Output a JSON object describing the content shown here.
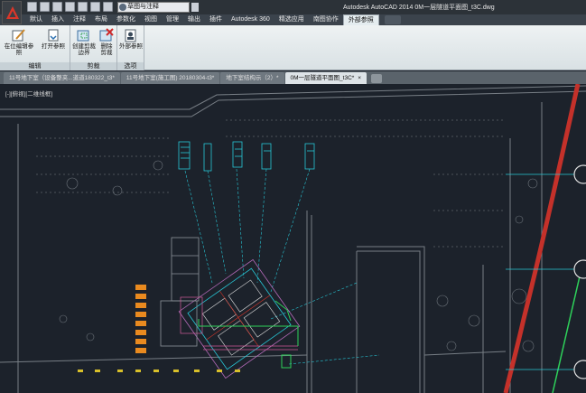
{
  "quick_access": {
    "workspace": "草图与注释",
    "icons": [
      "new-icon",
      "open-icon",
      "save-icon",
      "save-as-icon",
      "print-icon",
      "undo-icon",
      "redo-icon"
    ]
  },
  "app_title": "Autodesk AutoCAD 2014    0M一层隧道平面图_t3C.dwg",
  "ribbon_tabs": [
    {
      "label": "默认"
    },
    {
      "label": "插入"
    },
    {
      "label": "注释"
    },
    {
      "label": "布局"
    },
    {
      "label": "参数化"
    },
    {
      "label": "视图"
    },
    {
      "label": "管理"
    },
    {
      "label": "输出"
    },
    {
      "label": "插件"
    },
    {
      "label": "Autodesk 360"
    },
    {
      "label": "精选应用"
    },
    {
      "label": "南图协作"
    },
    {
      "label": "外部参照"
    }
  ],
  "ribbon_active_tab": "外部参照",
  "ribbon_groups": {
    "edit": {
      "label": "编辑",
      "buttons": [
        {
          "line1": "在位编辑参照",
          "line2": ""
        },
        {
          "line1": "打开参照",
          "line2": ""
        }
      ]
    },
    "clip": {
      "label": "剪裁",
      "buttons": [
        {
          "line1": "创建剪裁",
          "line2": "边界"
        },
        {
          "line1": "删除",
          "line2": "剪裁"
        }
      ]
    },
    "options": {
      "label": "选项",
      "buttons": [
        {
          "line1": "外部参照",
          "line2": ""
        }
      ]
    }
  },
  "doc_tabs": [
    {
      "label": "11号地下室（设备整夹...道道180322_t3*"
    },
    {
      "label": "11号地下室(施工图) 20180304-t3*"
    },
    {
      "label": "地下室结构示（2）*"
    },
    {
      "label": "0M一层隧道平面图_t3C*",
      "close": "×"
    }
  ],
  "viewport_label": "[-][俯视][二维线框]",
  "colors": {
    "canvas_bg": "#1c222b",
    "ribbon_bg": "#e4ecef",
    "accent_red": "#d9372a",
    "cad_cyan": "#27c7d6",
    "cad_green": "#2ed15a",
    "cad_orange": "#e98a1f",
    "cad_red_road": "#c4312a"
  }
}
